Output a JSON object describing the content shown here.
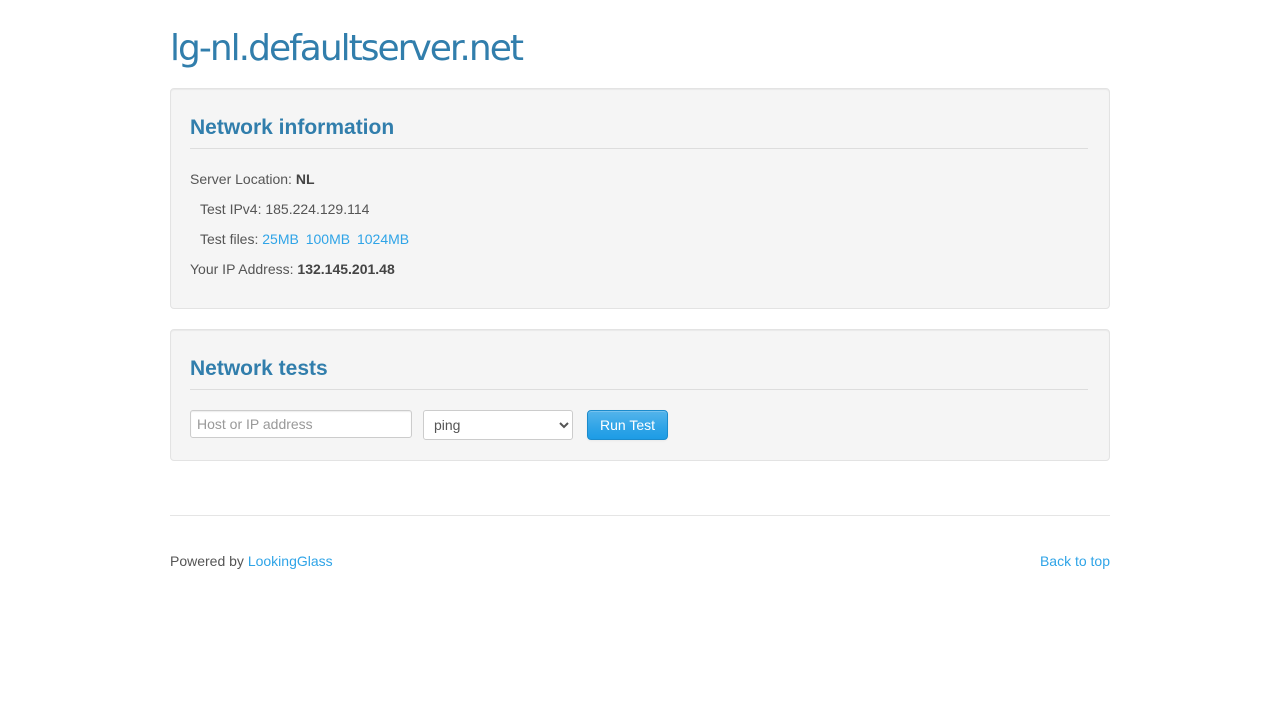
{
  "header": {
    "title": "lg-nl.defaultserver.net"
  },
  "network_info": {
    "heading": "Network information",
    "server_location_label": "Server Location:",
    "server_location_value": "NL",
    "test_ipv4_label": "Test IPv4:",
    "test_ipv4_value": "185.224.129.114",
    "test_files_label": "Test files:",
    "test_files": [
      "25MB",
      "100MB",
      "1024MB"
    ],
    "your_ip_label": "Your IP Address:",
    "your_ip_value": "132.145.201.48"
  },
  "network_tests": {
    "heading": "Network tests",
    "host_placeholder": "Host or IP address",
    "host_value": "",
    "command_selected": "ping",
    "run_button": "Run Test"
  },
  "footer": {
    "powered_by_label": "Powered by",
    "powered_by_link": "LookingGlass",
    "back_to_top": "Back to top"
  },
  "colors": {
    "heading": "#317eac",
    "link": "#2fa4e7",
    "button": "#2fa4e7",
    "well_background": "#f5f5f5"
  }
}
